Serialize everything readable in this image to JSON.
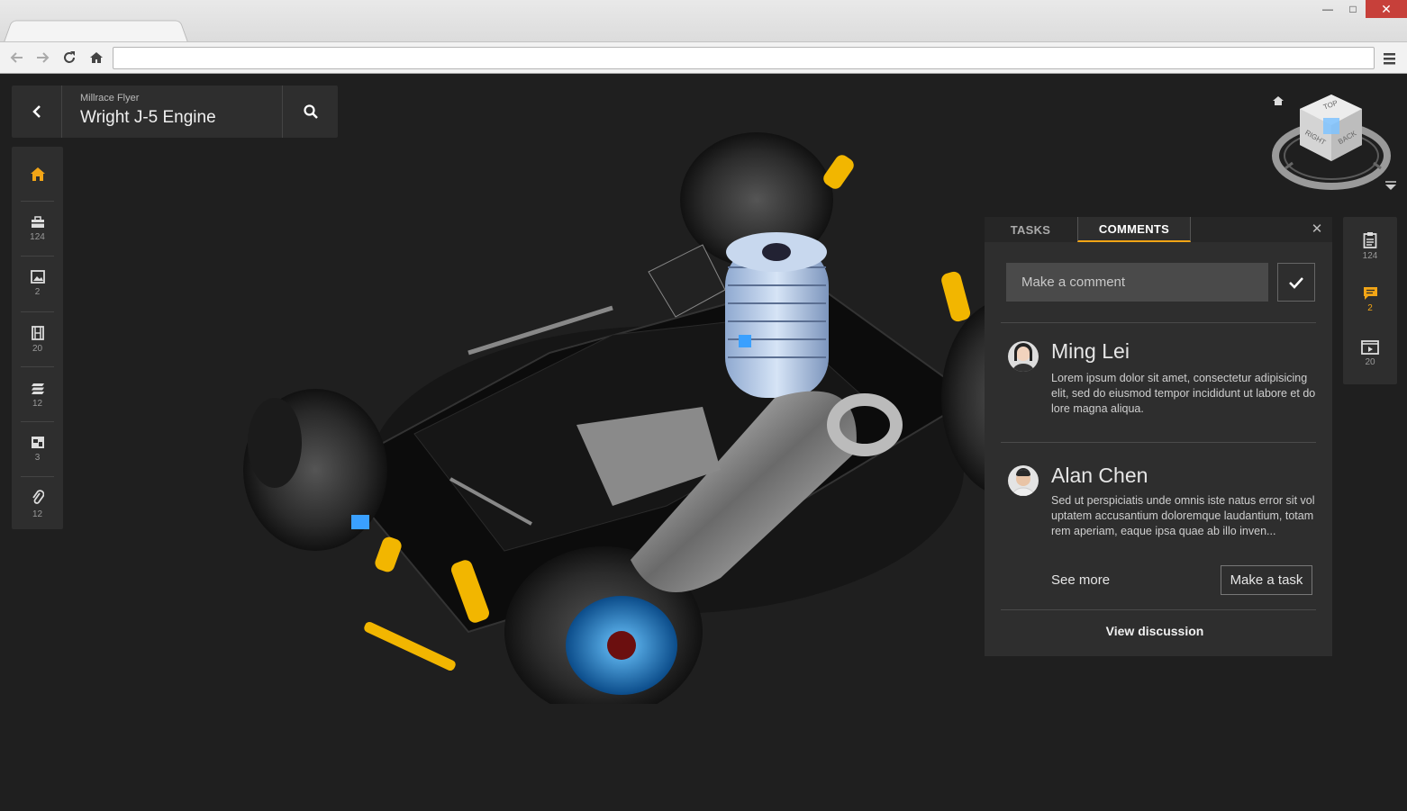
{
  "browser": {
    "window_controls": [
      "minimize",
      "maximize",
      "close"
    ],
    "nav_icons": [
      "back-arrow-icon",
      "forward-arrow-icon",
      "reload-icon",
      "home-icon"
    ],
    "url": ""
  },
  "header": {
    "project": "Millrace Flyer",
    "title": "Wright J-5 Engine"
  },
  "left_rail": {
    "items": [
      {
        "icon": "home-icon",
        "count": ""
      },
      {
        "icon": "toolbox-icon",
        "count": "124"
      },
      {
        "icon": "image-icon",
        "count": "2"
      },
      {
        "icon": "film-icon",
        "count": "20"
      },
      {
        "icon": "layers-icon",
        "count": "12"
      },
      {
        "icon": "gallery-icon",
        "count": "3"
      },
      {
        "icon": "paperclip-icon",
        "count": "12"
      }
    ]
  },
  "viewcube": {
    "faces": [
      "TOP",
      "RIGHT",
      "BACK"
    ]
  },
  "panel": {
    "tabs": [
      {
        "label": "TASKS"
      },
      {
        "label": "COMMENTS"
      }
    ],
    "active_tab": "COMMENTS",
    "comment_placeholder": "Make a comment",
    "comments": [
      {
        "author": "Ming Lei",
        "text": "Lorem ipsum dolor sit amet, consectetur adipisicing elit, sed do eiusmod tempor incididunt ut labore et dolore magna aliqua."
      },
      {
        "author": "Alan Chen",
        "text": "Sed ut perspiciatis unde omnis iste natus error sit voluptatem accusantium doloremque laudantium, totam rem aperiam, eaque ipsa quae ab illo inven..."
      }
    ],
    "see_more": "See more",
    "make_task": "Make a task",
    "view_discussion": "View discussion"
  },
  "right_rail": {
    "items": [
      {
        "icon": "clipboard-icon",
        "count": "124"
      },
      {
        "icon": "comment-icon",
        "count": "2"
      },
      {
        "icon": "video-icon",
        "count": "20"
      }
    ]
  },
  "colors": {
    "accent": "#f2a516",
    "panel_bg": "#2e2e2e",
    "viewport_bg": "#1f1f1f"
  }
}
